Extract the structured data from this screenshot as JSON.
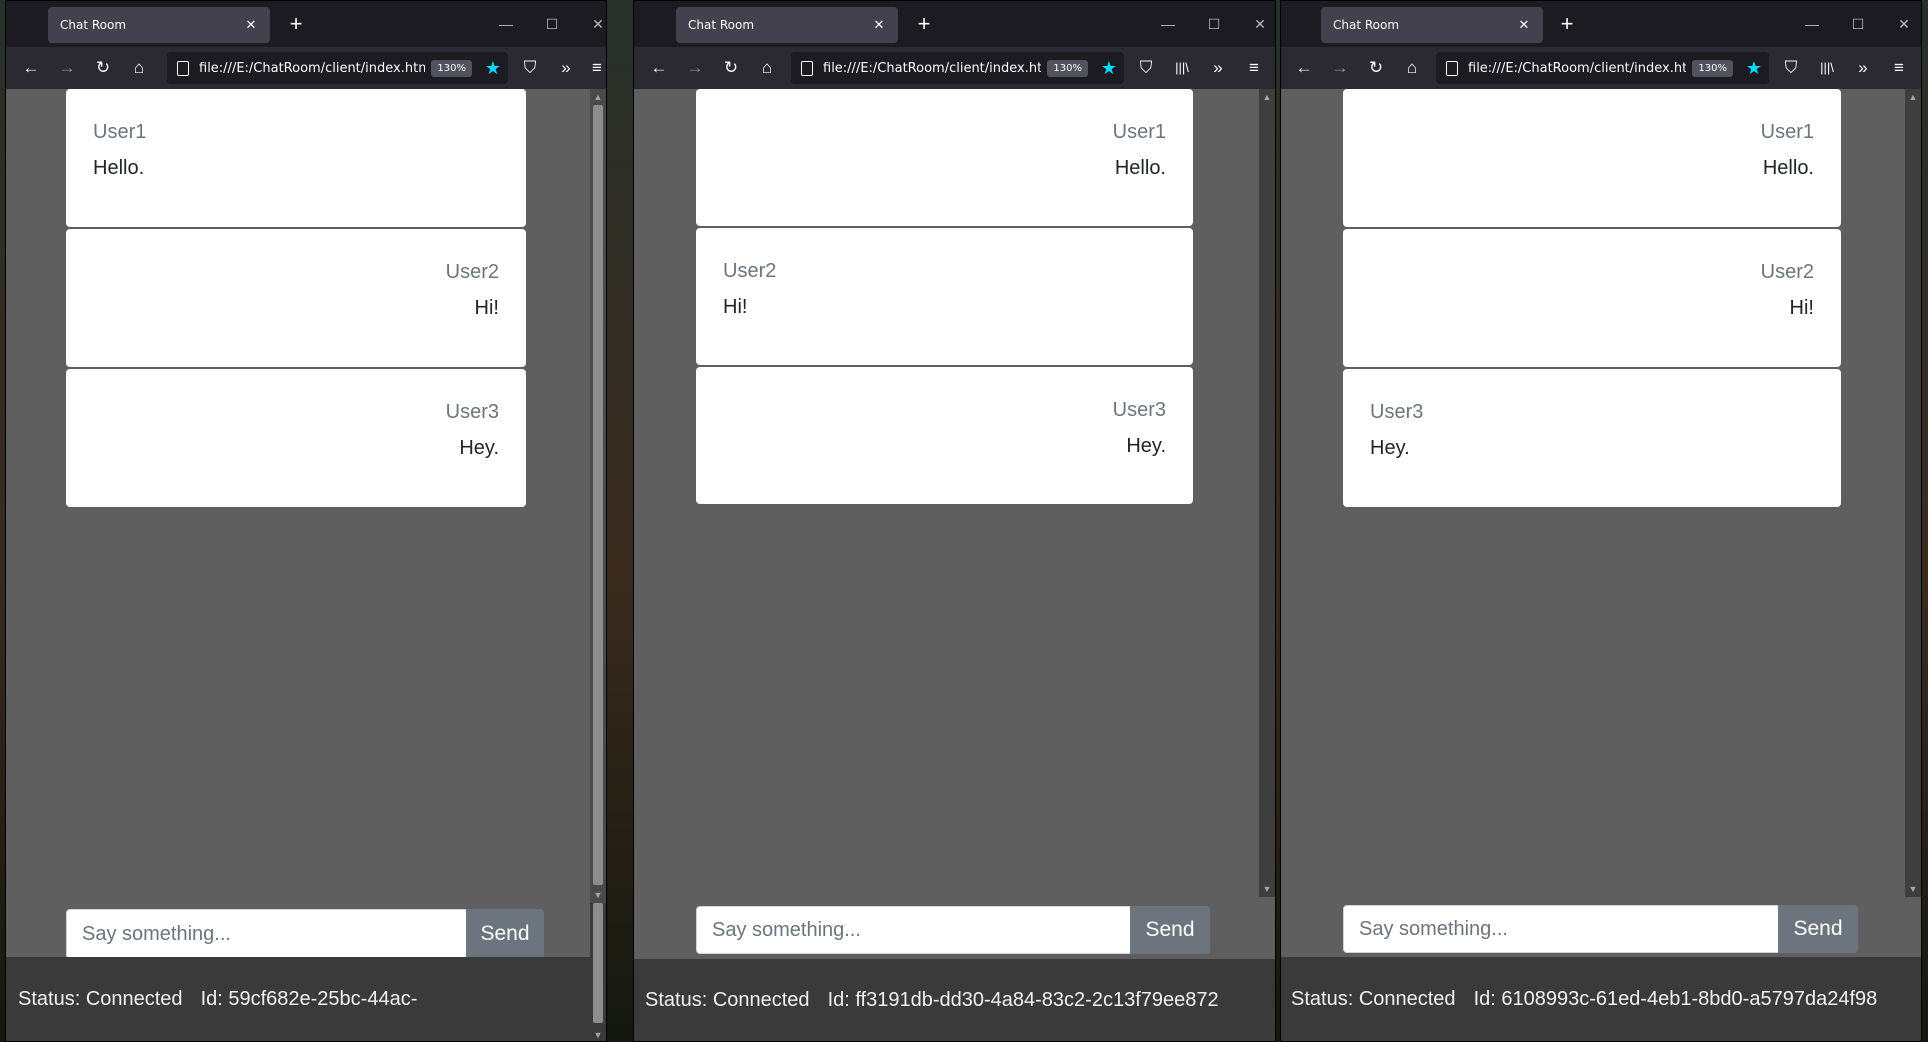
{
  "browser": {
    "tab_title": "Chat Room",
    "tab_close": "✕",
    "new_tab": "+",
    "url": "file:///E:/ChatRoom/client/index.html",
    "zoom": "130%",
    "star_color": "#00ddff"
  },
  "icons": {
    "back": "←",
    "forward": "→",
    "reload": "↻",
    "home": "⌂",
    "pocket": "⛉",
    "library": "|||\\",
    "overflow": "»",
    "menu": "≡",
    "minimize": "—",
    "maximize": "☐",
    "close": "✕",
    "star": "★",
    "scroll_up": "▲",
    "scroll_down": "▼"
  },
  "chat": {
    "input_placeholder": "Say something...",
    "send_label": "Send",
    "status": "Status: Connected"
  },
  "windows": [
    {
      "messages": [
        {
          "user": "User1",
          "text": "Hello.",
          "align": "left"
        },
        {
          "user": "User2",
          "text": "Hi!",
          "align": "right"
        },
        {
          "user": "User3",
          "text": "Hey.",
          "align": "right"
        }
      ],
      "id_text": "Id: 59cf682e-25bc-44ac-"
    },
    {
      "messages": [
        {
          "user": "User1",
          "text": "Hello.",
          "align": "right"
        },
        {
          "user": "User2",
          "text": "Hi!",
          "align": "left"
        },
        {
          "user": "User3",
          "text": "Hey.",
          "align": "right"
        }
      ],
      "id_text": "Id: ff3191db-dd30-4a84-83c2-2c13f79ee872"
    },
    {
      "messages": [
        {
          "user": "User1",
          "text": "Hello.",
          "align": "right"
        },
        {
          "user": "User2",
          "text": "Hi!",
          "align": "right"
        },
        {
          "user": "User3",
          "text": "Hey.",
          "align": "left"
        }
      ],
      "id_text": "Id: 6108993c-61ed-4eb1-8bd0-a5797da24f98"
    }
  ]
}
